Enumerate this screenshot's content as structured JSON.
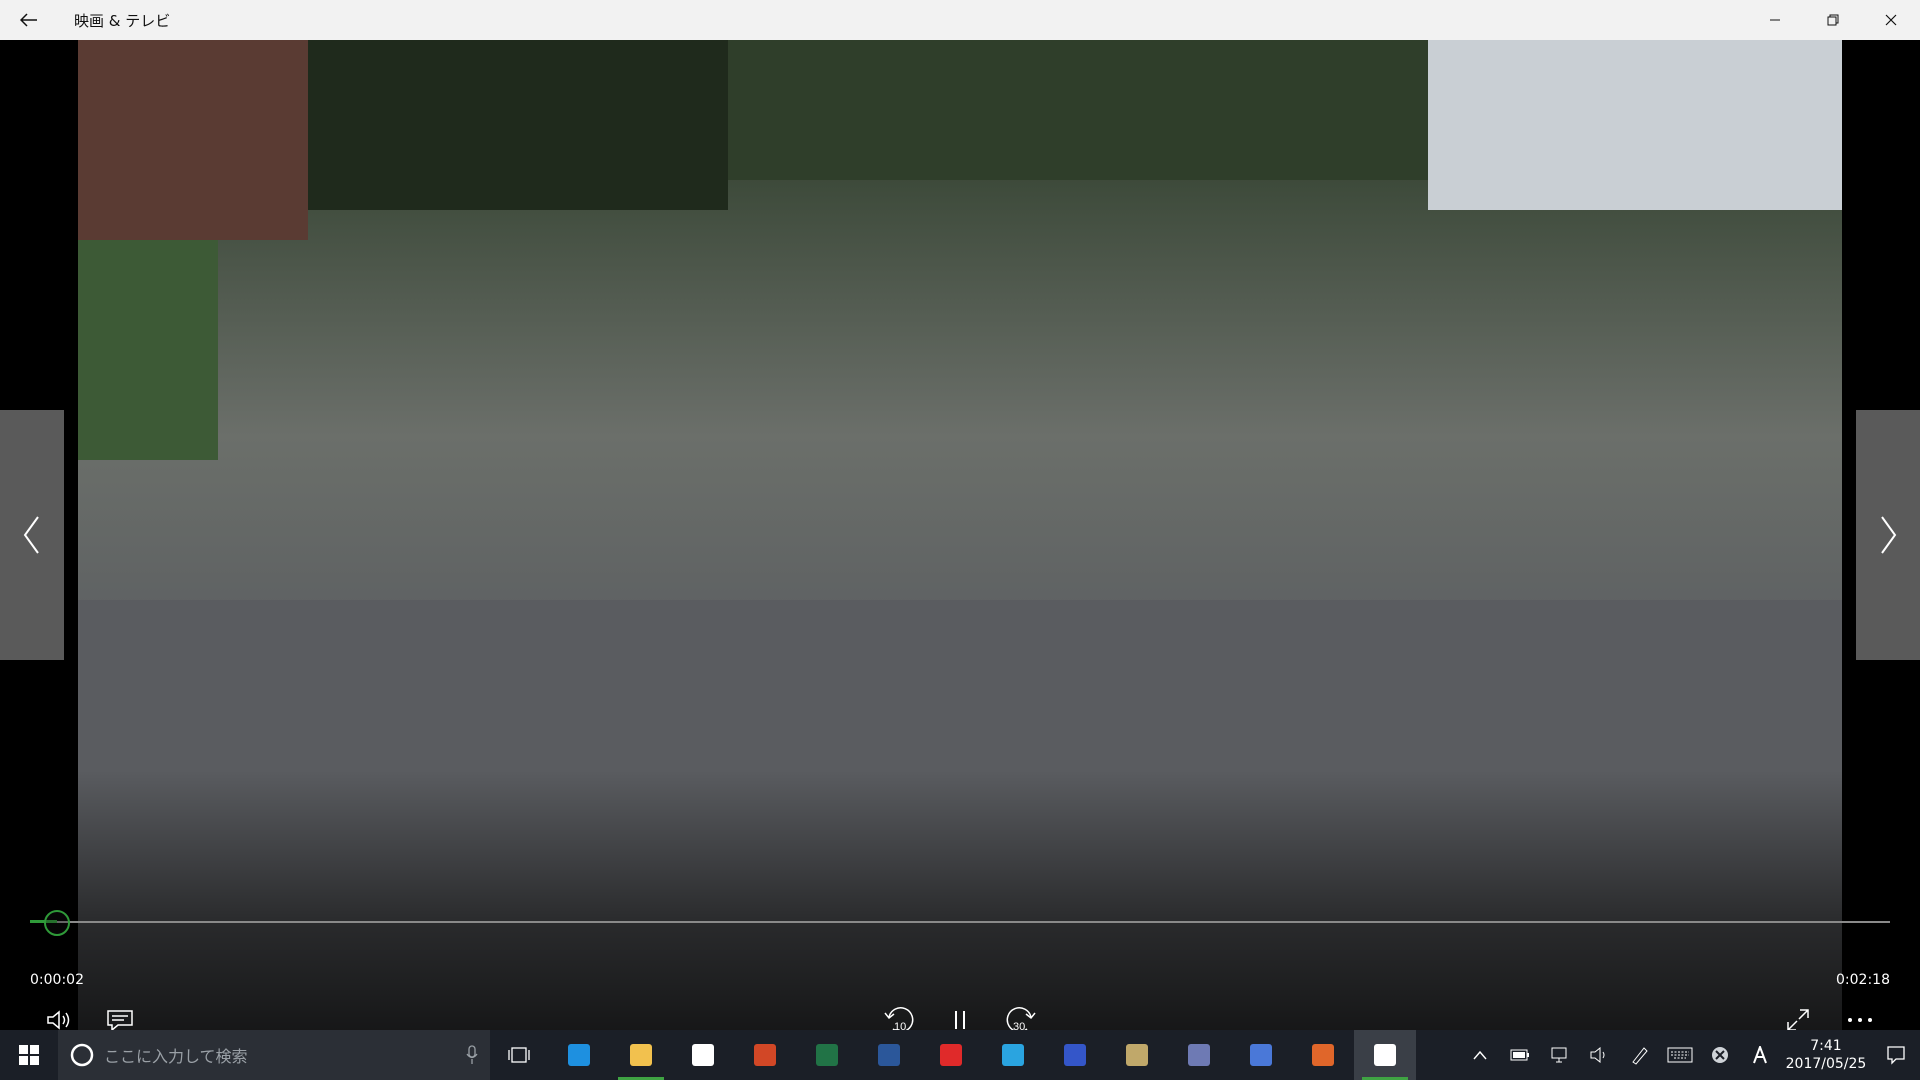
{
  "window": {
    "title": "映画 & テレビ",
    "accent": "#2f9a39"
  },
  "player": {
    "current_time": "0:00:02",
    "total_time": "0:02:18",
    "progress_fraction": 0.0145,
    "rewind_seconds": "10",
    "forward_seconds": "30"
  },
  "taskbar": {
    "search_placeholder": "ここに入力して検索",
    "apps": [
      {
        "name": "edge-icon",
        "color": "#1e90e0"
      },
      {
        "name": "file-explorer-icon",
        "color": "#f2c14e"
      },
      {
        "name": "store-icon",
        "color": "#ffffff"
      },
      {
        "name": "powerpoint-icon",
        "color": "#d24726"
      },
      {
        "name": "excel-icon",
        "color": "#217346"
      },
      {
        "name": "word-icon",
        "color": "#2b579a"
      },
      {
        "name": "red-app-icon",
        "color": "#e02a2a"
      },
      {
        "name": "play-app-icon",
        "color": "#2aa4e0"
      },
      {
        "name": "b98-app-icon",
        "color": "#3456c9"
      },
      {
        "name": "paint-app-icon",
        "color": "#c0a86a"
      },
      {
        "name": "dark-app-icon",
        "color": "#6e7ab4"
      },
      {
        "name": "globe-app-icon",
        "color": "#4a78d8"
      },
      {
        "name": "stamp-app-icon",
        "color": "#e0662a"
      },
      {
        "name": "movies-tv-icon",
        "color": "#ffffff"
      }
    ],
    "clock_time": "7:41",
    "clock_date": "2017/05/25"
  }
}
